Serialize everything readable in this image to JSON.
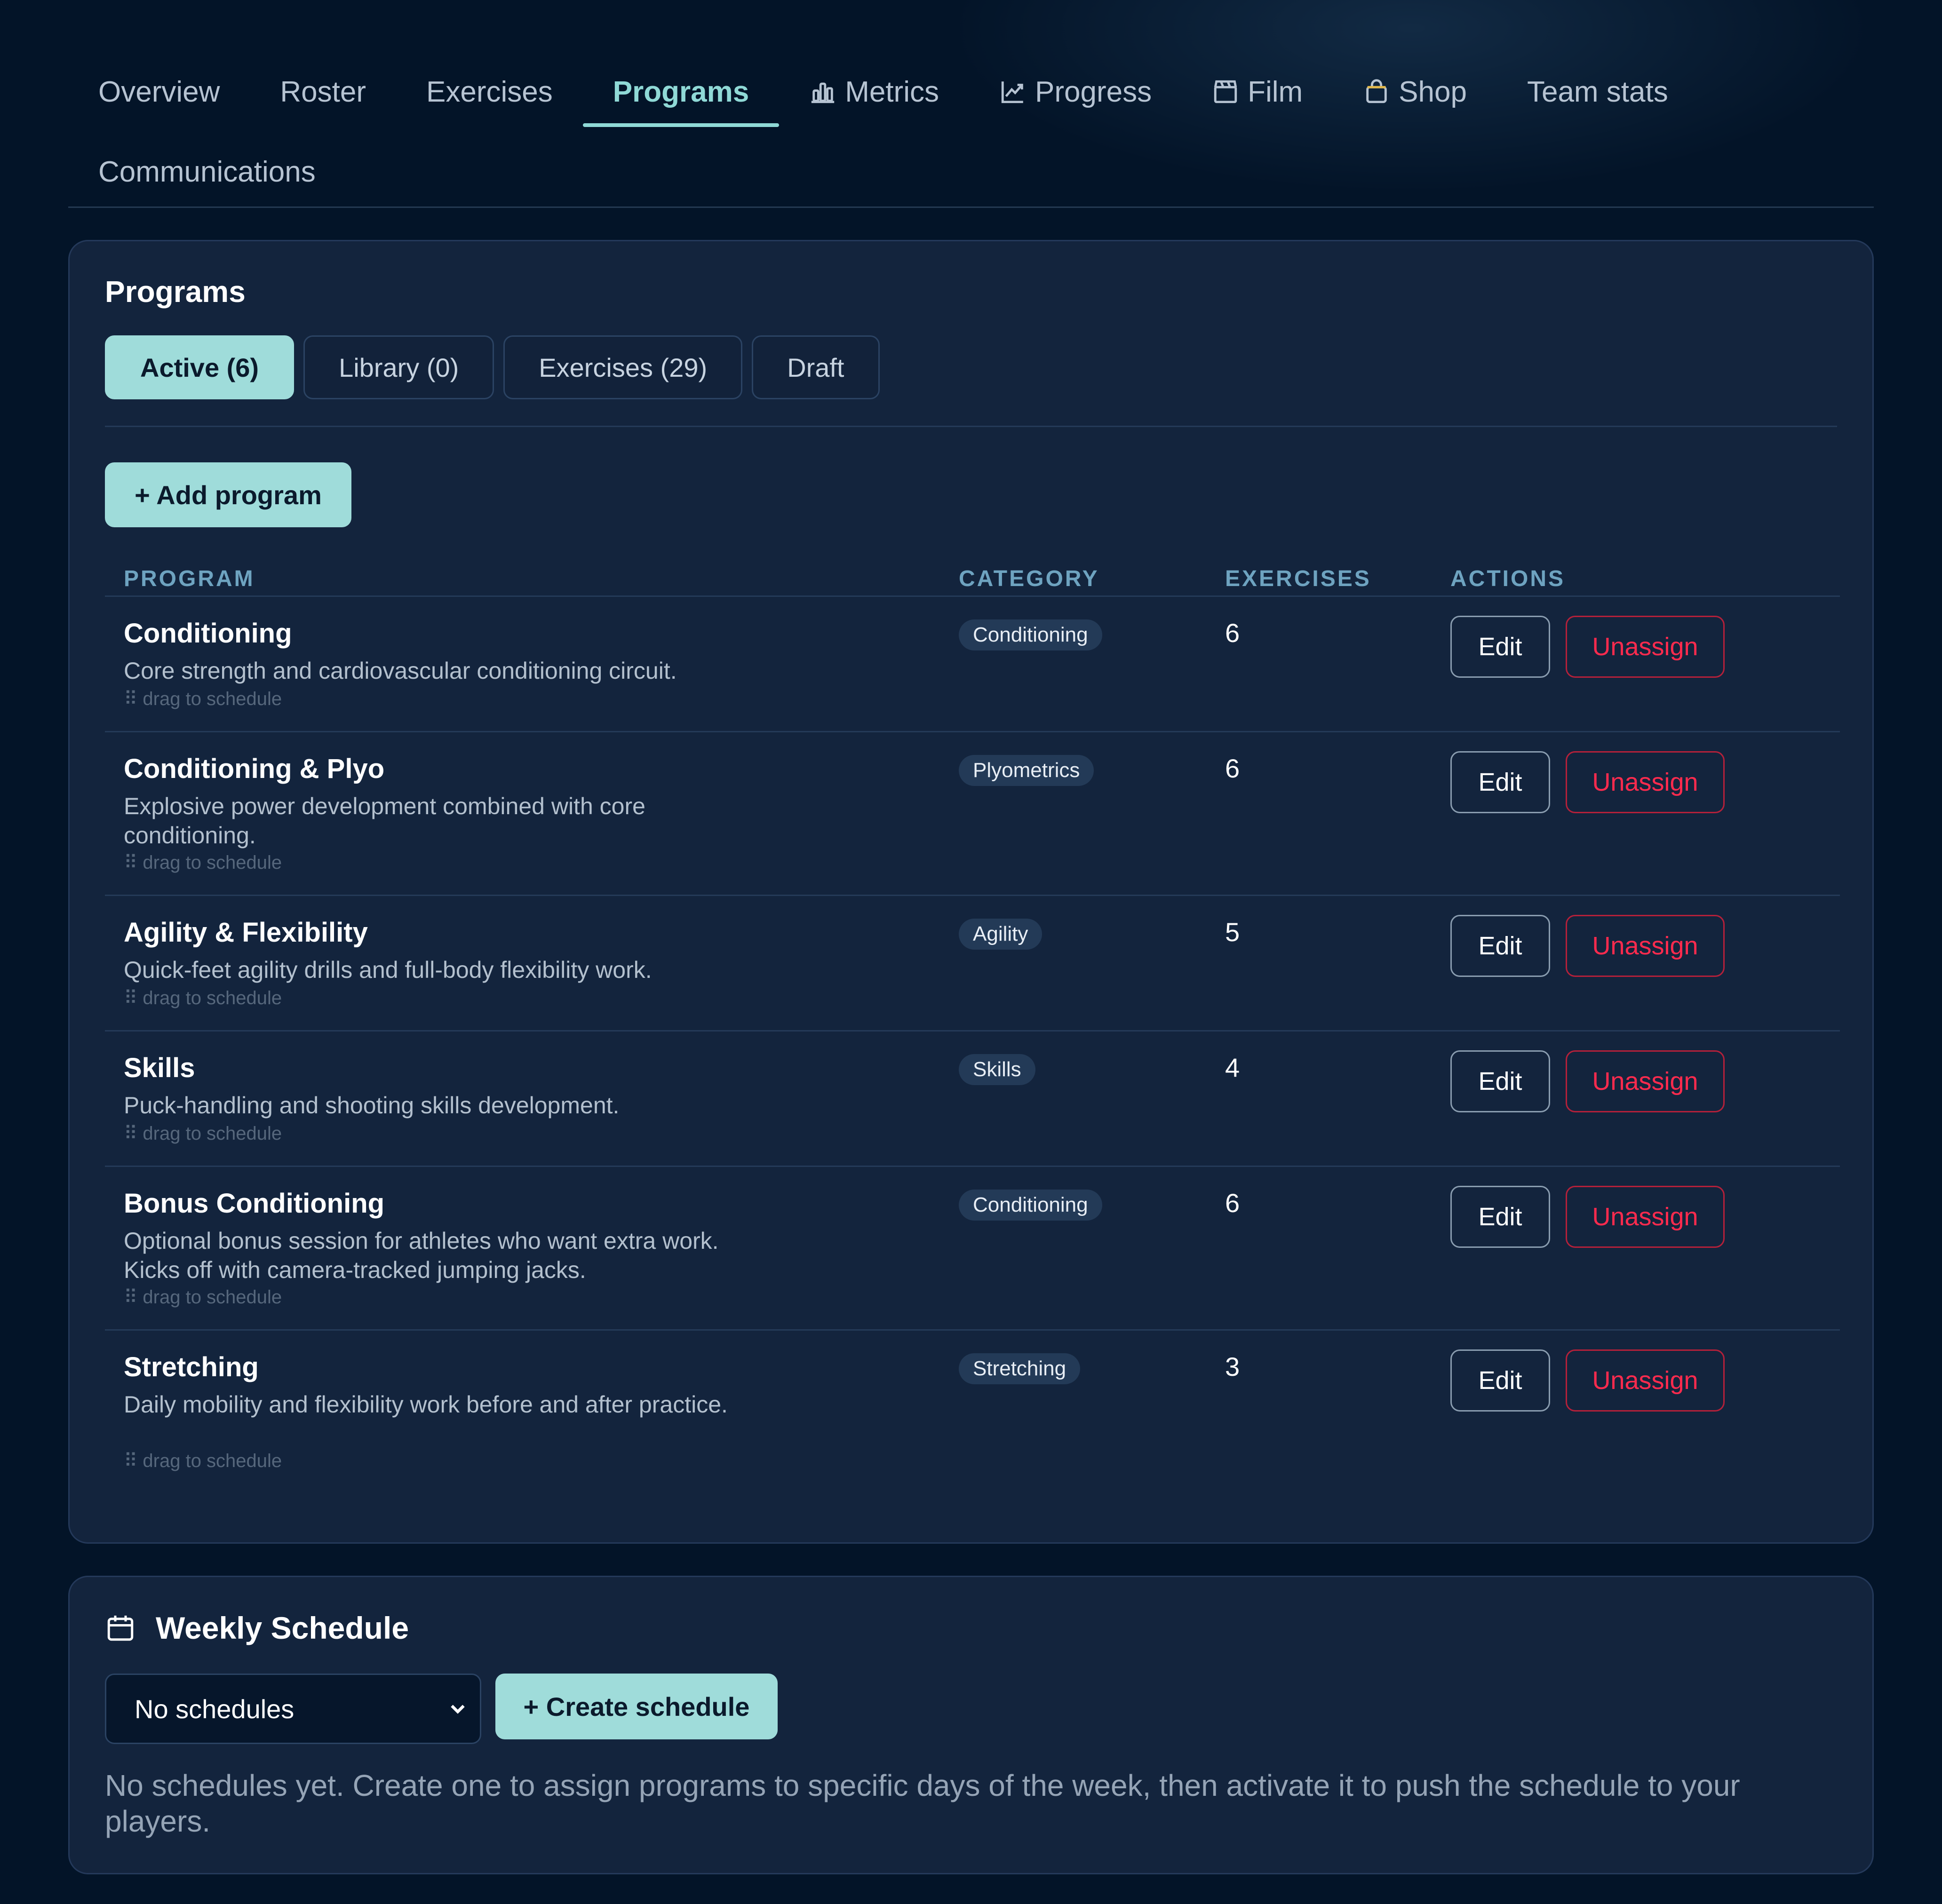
{
  "nav": {
    "tabs": [
      {
        "label": "Overview",
        "icon": null,
        "active": false
      },
      {
        "label": "Roster",
        "icon": null,
        "active": false
      },
      {
        "label": "Exercises",
        "icon": null,
        "active": false
      },
      {
        "label": "Programs",
        "icon": null,
        "active": true
      },
      {
        "label": "Metrics",
        "icon": "bar-chart-icon",
        "active": false
      },
      {
        "label": "Progress",
        "icon": "line-chart-icon",
        "active": false
      },
      {
        "label": "Film",
        "icon": "clapperboard-icon",
        "active": false
      },
      {
        "label": "Shop",
        "icon": "shopping-bag-icon",
        "active": false
      },
      {
        "label": "Team stats",
        "icon": null,
        "active": false
      },
      {
        "label": "Communications",
        "icon": null,
        "active": false
      }
    ]
  },
  "programs": {
    "title": "Programs",
    "subtabs": [
      {
        "label": "Active (6)",
        "active": true
      },
      {
        "label": "Library (0)",
        "active": false
      },
      {
        "label": "Exercises (29)",
        "active": false
      },
      {
        "label": "Draft",
        "active": false
      }
    ],
    "add_label": "+ Add program",
    "columns": {
      "program": "PROGRAM",
      "category": "CATEGORY",
      "exercises": "EXERCISES",
      "actions": "ACTIONS"
    },
    "drag_hint": "⠿ drag to schedule",
    "edit_label": "Edit",
    "unassign_label": "Unassign",
    "rows": [
      {
        "name": "Conditioning",
        "description": "Core strength and cardiovascular conditioning circuit.",
        "category": "Conditioning",
        "exercises": "6"
      },
      {
        "name": "Conditioning & Plyo",
        "description": "Explosive power development combined with core conditioning.",
        "category": "Plyometrics",
        "exercises": "6"
      },
      {
        "name": "Agility & Flexibility",
        "description": "Quick-feet agility drills and full-body flexibility work.",
        "category": "Agility",
        "exercises": "5"
      },
      {
        "name": "Skills",
        "description": "Puck-handling and shooting skills development.",
        "category": "Skills",
        "exercises": "4"
      },
      {
        "name": "Bonus Conditioning",
        "description": "Optional bonus session for athletes who want extra work. Kicks off with camera-tracked jumping jacks.",
        "category": "Conditioning",
        "exercises": "6"
      },
      {
        "name": "Stretching",
        "description": "Daily mobility and flexibility work before and after practice.",
        "category": "Stretching",
        "exercises": "3"
      }
    ]
  },
  "schedule": {
    "title": "Weekly Schedule",
    "icon": "calendar-icon",
    "select_value": "No schedules",
    "create_label": "+ Create schedule",
    "empty_message": "No schedules yet. Create one to assign programs to specific days of the week, then activate it to push the schedule to your players."
  },
  "colors": {
    "background": "#031428",
    "panel": "#13243d",
    "accent": "#9fdcda",
    "active_tab": "#8fd9d6",
    "danger": "#ff2b4e"
  }
}
